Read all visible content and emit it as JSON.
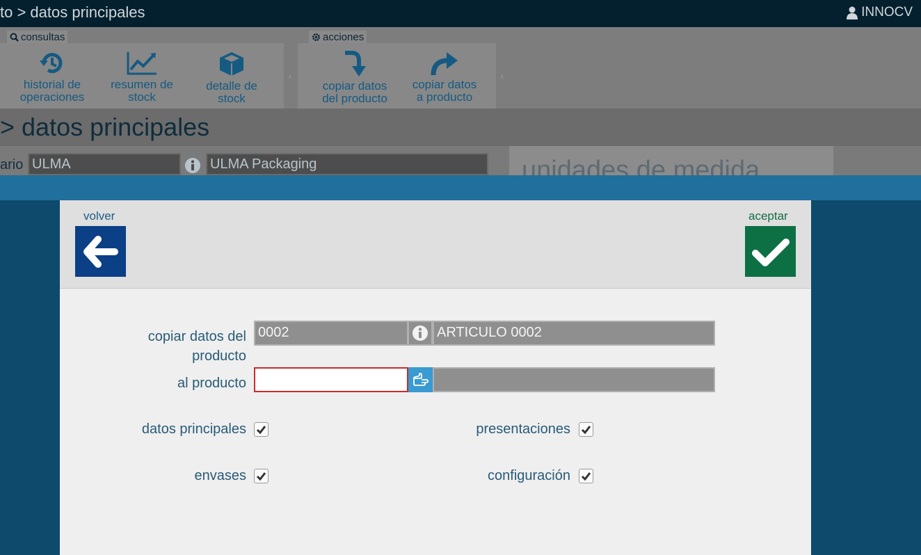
{
  "topbar": {
    "breadcrumb": "to > datos principales",
    "user_name": "INNOCV"
  },
  "ribbon": {
    "consultas_label": "consultas",
    "acciones_label": "acciones",
    "buttons": [
      {
        "line1": "historial de",
        "line2": "operaciones",
        "icon": "history-icon"
      },
      {
        "line1": "resumen de",
        "line2": "stock",
        "icon": "line-chart-icon"
      },
      {
        "line1": "detalle de",
        "line2": "stock",
        "icon": "cube-icon"
      },
      {
        "line1": "copiar datos",
        "line2": "del producto",
        "icon": "arrow-down-turn-icon"
      },
      {
        "line1": "copiar datos",
        "line2": "a producto",
        "icon": "share-arrow-icon"
      }
    ],
    "collapse_glyph": "‹"
  },
  "section": {
    "title": "> datos principales"
  },
  "background_row": {
    "label_fragment": "ario",
    "code_value": "ULMA",
    "name_value": "ULMA Packaging",
    "right_panel_title": "unidades de medida"
  },
  "modal": {
    "back_label": "volver",
    "accept_label": "aceptar",
    "copy_from_label": "copiar datos del producto",
    "copy_from_code": "0002",
    "copy_from_name": "ARTICULO 0002",
    "to_product_label": "al producto",
    "to_product_code": "",
    "to_product_name": "",
    "options": {
      "datos_principales": {
        "label": "datos principales",
        "checked": true
      },
      "presentaciones": {
        "label": "presentaciones",
        "checked": true
      },
      "envases": {
        "label": "envases",
        "checked": true
      },
      "configuracion": {
        "label": "configuración",
        "checked": true
      }
    }
  },
  "colors": {
    "back_button": "#0b3f86",
    "accept_button": "#0d7044",
    "pick_button": "#3a9bd2",
    "invalid_border": "#cc2a2a"
  }
}
